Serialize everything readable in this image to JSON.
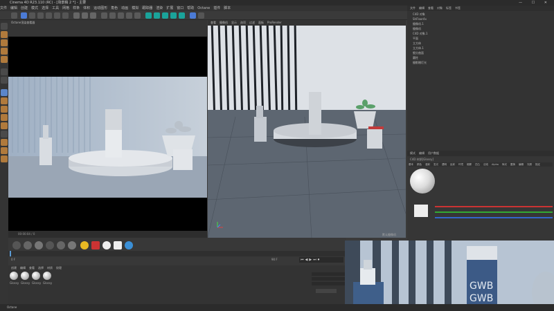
{
  "titlebar": {
    "title": "Cinema 4D R23.110 (RC) - [场景稿 2 *] - 主要"
  },
  "menu": [
    "文件",
    "编辑",
    "创建",
    "模式",
    "选择",
    "工具",
    "网格",
    "样条",
    "体积",
    "运动图形",
    "角色",
    "动画",
    "模拟",
    "跟踪器",
    "渲染",
    "扩展",
    "窗口",
    "帮助",
    "Octane",
    "插件",
    "脚本"
  ],
  "render_view": {
    "tabs": [
      "视图",
      "Octane渲染查看器"
    ],
    "status_text": "00:00:04 / 0"
  },
  "viewport": {
    "tabs": [
      "查看",
      "摄像机",
      "显示",
      "选项",
      "过滤",
      "面板",
      "ProRender"
    ],
    "camera_label": "默认摄像机"
  },
  "object_manager": {
    "tabs": [
      "文件",
      "编辑",
      "查看",
      "对象",
      "标签",
      "书签"
    ],
    "rows": [
      "C4D 对象",
      "ShFloor4x",
      "摄像机.1",
      "摄像机",
      "C4D 对象.1",
      "平面",
      "立方体",
      "立方体.1",
      "细分曲面",
      "圆柱",
      "摄影棚灯光"
    ]
  },
  "attribute_manager": {
    "tabs": [
      "模式",
      "编辑",
      "用户数据"
    ],
    "material_name": "C4D 材质[Glossy]",
    "channel_tabs": [
      "基本",
      "颜色",
      "漫射",
      "发光",
      "透明",
      "反射",
      "环境",
      "烟雾",
      "凹凸",
      "法线",
      "Alpha",
      "辉光",
      "置换",
      "编辑",
      "光照",
      "指定"
    ]
  },
  "timeline": {
    "start": "0 F",
    "end": "90 F"
  },
  "material_manager": {
    "tabs": [
      "创建",
      "编辑",
      "查看",
      "选择",
      "材质",
      "纹理"
    ],
    "materials": [
      "Glossy",
      "Glossy",
      "Glossy",
      "Glossy"
    ]
  },
  "statusbar": {
    "text": "Octane"
  }
}
